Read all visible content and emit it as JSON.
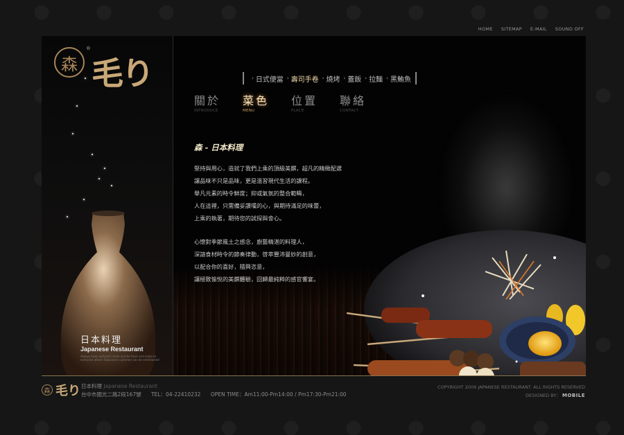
{
  "top_links": [
    "HOME",
    "SITEMAP",
    "E-MAIL",
    "SOUND OFF"
  ],
  "brand": {
    "seal_char": "森",
    "reg_mark": "®",
    "logo_text": "毛り"
  },
  "left_panel": {
    "label_jp": "日本料理",
    "label_en": "Japanese Restaurant",
    "tiny_text": "Always keep authentic taste and be fresh and make to everyone where Taiwanese customer can be entertained"
  },
  "submenu": {
    "items": [
      {
        "label": "日式便當",
        "active": false
      },
      {
        "label": "壽司手卷",
        "active": true
      },
      {
        "label": "燒烤",
        "active": false
      },
      {
        "label": "蓋飯",
        "active": false
      },
      {
        "label": "拉麵",
        "active": false
      },
      {
        "label": "黑鮪魚",
        "active": false
      }
    ]
  },
  "mainnav": [
    {
      "zh": "關於",
      "en": "INTRODUCE",
      "active": false
    },
    {
      "zh": "菜色",
      "en": "MENU",
      "active": true
    },
    {
      "zh": "位置",
      "en": "PLACE",
      "active": false
    },
    {
      "zh": "聯絡",
      "en": "CONTACT",
      "active": false
    }
  ],
  "content": {
    "title": "森 - 日本料理",
    "para1": [
      "堅持與用心，造就了我們上乘的頂級美饌，超凡的精緻配選",
      "讓品味不只是品味，更是溫習現代生活的課程。",
      "舉凡元素的時令鮮度；抑或氣氛的整合範疇，",
      "人在這裡，只需備妥讚嘆的心，與期待滿足的味蕾，",
      "上乘的執著，期待您的試探與會心。"
    ],
    "para2": [
      "心懷對季節風土之感念，廚藝精湛的料理人，",
      "深諳食材時令的節奏律動，啓萃豐沛曼妙的創意，",
      "以配合你的喜好，隨興恣意，",
      "讓極致愉悅的美饌體驗，回歸最純粹的感官饗宴。"
    ]
  },
  "footer": {
    "seal_char": "森",
    "logo_text": "毛り",
    "name_zh": "日本料理",
    "name_en": "Japanese Restaurant",
    "address": "台中市國光二路2段167號",
    "tel": "TEL：04-22410232",
    "hours": "OPEN TIME：Am11:00-Pm14:00 / Pm17:30-Pm21:00",
    "copyright": "COPYRIGHT 2009 JAPANESE RESTAURANT. ALL RIGHTS RESERVED",
    "designed_by": "DESIGNED BY：",
    "designer": "MOBILE"
  }
}
